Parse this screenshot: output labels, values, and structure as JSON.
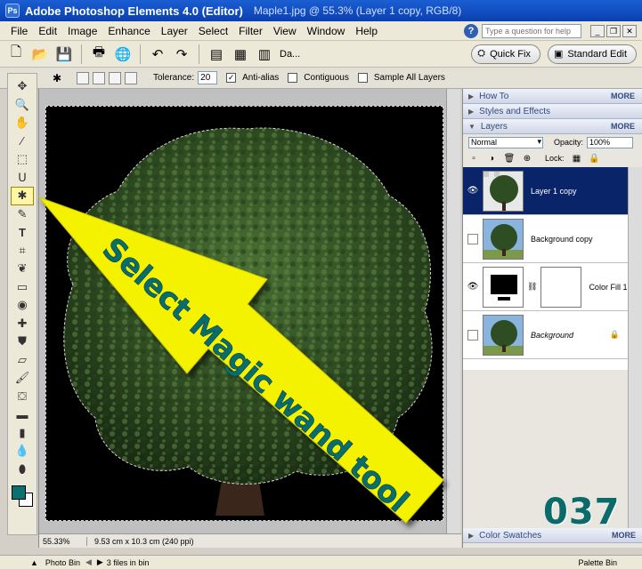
{
  "titlebar": {
    "app_title": "Adobe Photoshop Elements 4.0 (Editor)",
    "doc_title": "Maple1.jpg @ 55.3% (Layer 1 copy, RGB/8)"
  },
  "menubar": {
    "items": [
      "File",
      "Edit",
      "Image",
      "Enhance",
      "Layer",
      "Select",
      "Filter",
      "View",
      "Window",
      "Help"
    ],
    "help_placeholder": "Type a question for help"
  },
  "shortcuts": {
    "date_view_label": "Da...",
    "quick_fix_label": "Quick Fix",
    "standard_edit_label": "Standard Edit"
  },
  "options_bar": {
    "tolerance_label": "Tolerance:",
    "tolerance_value": "20",
    "anti_alias_label": "Anti-alias",
    "anti_alias_checked": true,
    "contiguous_label": "Contiguous",
    "sample_all_label": "Sample All Layers"
  },
  "colors": {
    "foreground": "#0a7070",
    "background": "#ffffff",
    "annotation_arrow": "#f5f200",
    "annotation_text": "#0a6d6d"
  },
  "status": {
    "zoom": "55.33%",
    "doc_size": "9.53 cm x 10.3 cm (240 ppi)"
  },
  "palette_bin": {
    "how_to_label": "How To",
    "styles_label": "Styles and Effects",
    "layers_label": "Layers",
    "more_label": "MORE",
    "blend_mode": "Normal",
    "opacity_label": "Opacity:",
    "opacity_value": "100%",
    "lock_label": "Lock:",
    "layers": [
      {
        "name": "Layer 1 copy",
        "visible": true,
        "selected": true
      },
      {
        "name": "Background copy",
        "visible": false,
        "selected": false
      },
      {
        "name": "Color Fill 1",
        "visible": true,
        "selected": false
      },
      {
        "name": "Background",
        "visible": false,
        "selected": false,
        "locked": true
      }
    ],
    "color_swatches_label": "Color Swatches"
  },
  "bottom_bar": {
    "photo_bin_label": "Photo Bin",
    "files_label": "3 files in bin",
    "palette_bin_label": "Palette Bin"
  },
  "annotation": {
    "arrow_text": "Select Magic wand tool",
    "number": "037"
  }
}
